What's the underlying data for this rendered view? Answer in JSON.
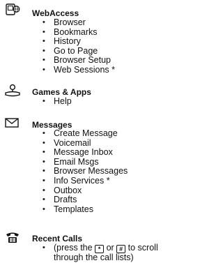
{
  "sections": [
    {
      "title": "WebAccess",
      "icon": "web-access-icon",
      "items": [
        "Browser",
        "Bookmarks",
        "History",
        "Go to Page",
        "Browser Setup",
        "Web Sessions *"
      ]
    },
    {
      "title": "Games & Apps",
      "icon": "games-apps-icon",
      "items": [
        "Help"
      ]
    },
    {
      "title": "Messages",
      "icon": "envelope-icon",
      "items": [
        "Create Message",
        "Voicemail",
        "Message Inbox",
        "Email Msgs",
        "Browser Messages",
        "Info Services *",
        "Outbox",
        "Drafts",
        "Templates"
      ]
    },
    {
      "title": "Recent Calls",
      "icon": "recent-calls-icon",
      "note_before": "(press the",
      "key1": "*",
      "note_middle": "or",
      "key2": "#",
      "note_after": "to scroll through the call lists)"
    }
  ]
}
